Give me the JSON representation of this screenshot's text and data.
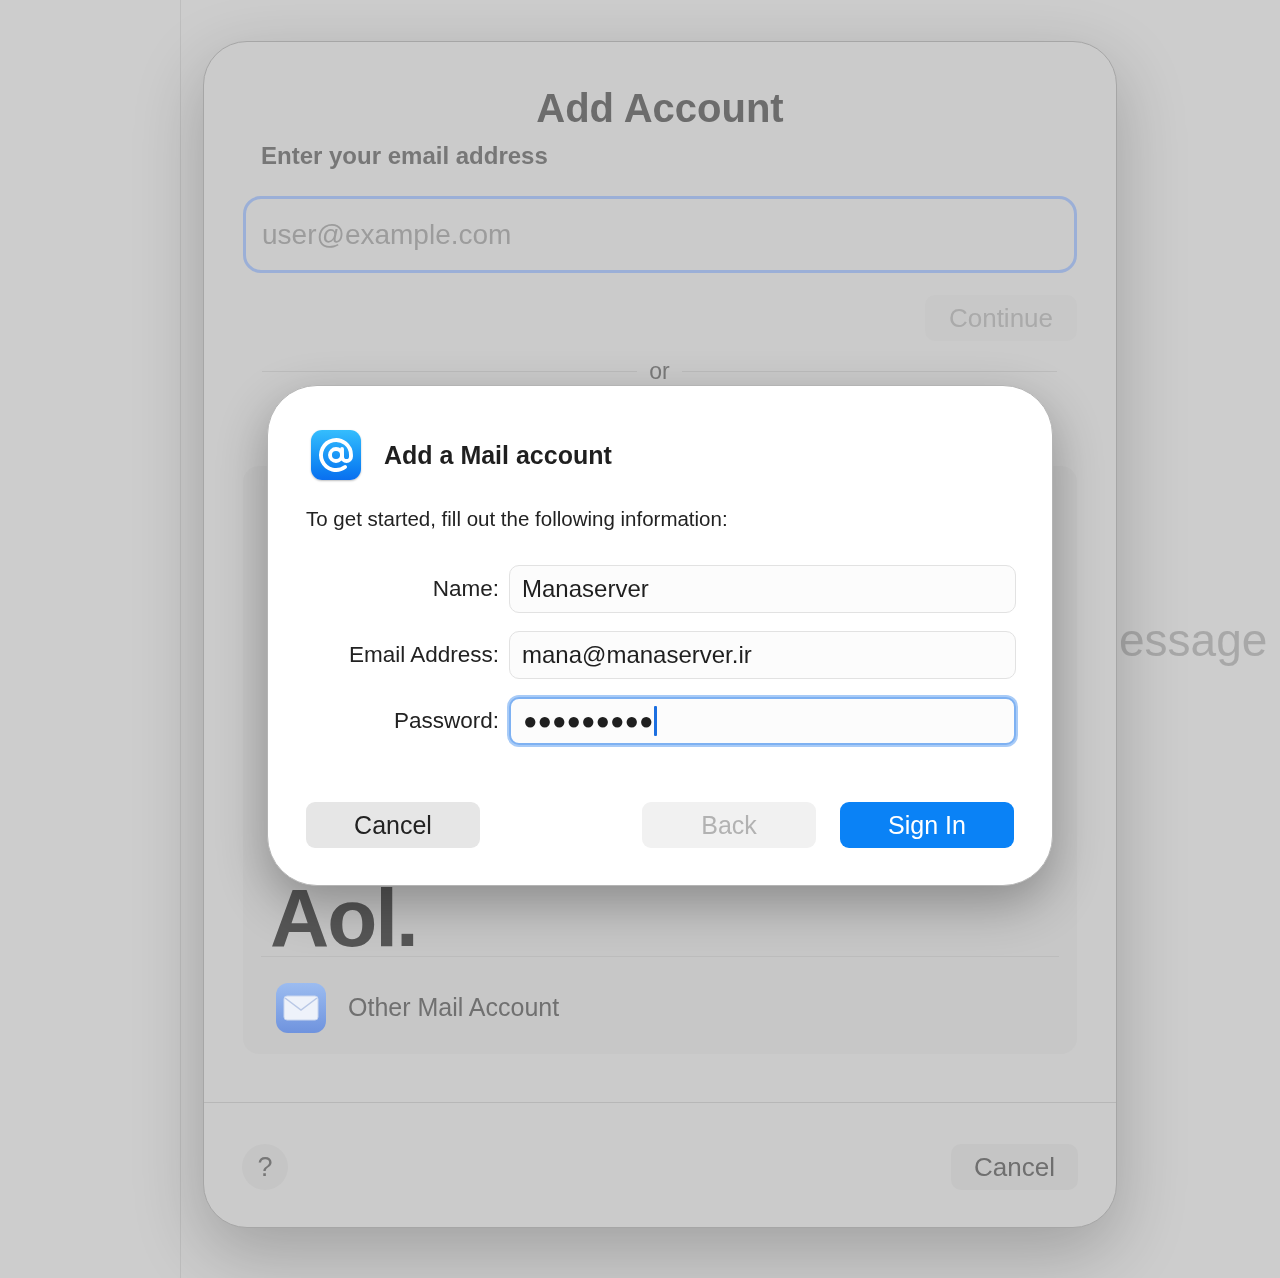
{
  "background_window": {
    "partial_text": "essage"
  },
  "sheet": {
    "title": "Add Account",
    "prompt": "Enter your email address",
    "email_field": {
      "placeholder": "user@example.com",
      "focused": true
    },
    "continue_button": {
      "label": "Continue",
      "disabled": true
    },
    "separator_label": "or",
    "providers": [
      {
        "kind": "logo",
        "label": "Aol."
      },
      {
        "kind": "item",
        "label": "Other Mail Account"
      }
    ],
    "help_button": {
      "label": "?"
    },
    "cancel_button": {
      "label": "Cancel"
    }
  },
  "dialog": {
    "title": "Add a Mail account",
    "instructions": "To get started, fill out the following information:",
    "fields": [
      {
        "label": "Name:",
        "value": "Manaserver",
        "focused": false
      },
      {
        "label": "Email Address:",
        "value": "mana@manaserver.ir",
        "focused": false
      },
      {
        "label": "Password:",
        "value": "●●●●●●●●●",
        "focused": true
      }
    ],
    "buttons": [
      {
        "label": "Cancel",
        "kind": "secondary",
        "disabled": false
      },
      {
        "label": "Back",
        "kind": "secondary",
        "disabled": true
      },
      {
        "label": "Sign In",
        "kind": "primary",
        "disabled": false
      }
    ]
  }
}
